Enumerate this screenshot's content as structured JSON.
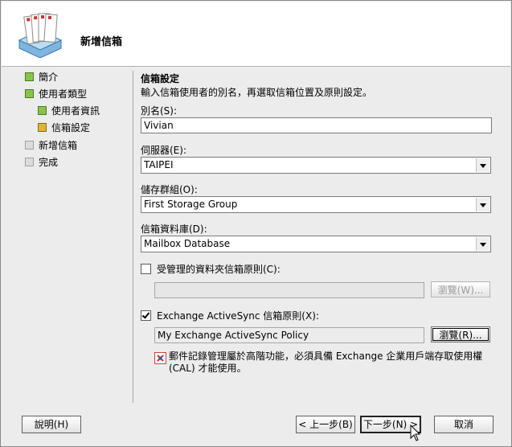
{
  "header": {
    "title": "新增信箱"
  },
  "steps": [
    {
      "label": "簡介",
      "state": "done"
    },
    {
      "label": "使用者類型",
      "state": "done"
    },
    {
      "label": "使用者資訊",
      "state": "done"
    },
    {
      "label": "信箱設定",
      "state": "current"
    },
    {
      "label": "新增信箱",
      "state": "pending"
    },
    {
      "label": "完成",
      "state": "pending"
    }
  ],
  "content": {
    "section_title": "信箱設定",
    "section_desc": "輸入信箱使用者的別名，再選取信箱位置及原則設定。",
    "alias_label": "別名(S):",
    "alias_value": "Vivian",
    "server_label": "伺服器(E):",
    "server_value": "TAIPEI",
    "storage_group_label": "儲存群組(O):",
    "storage_group_value": "First Storage Group",
    "mailbox_db_label": "信箱資料庫(D):",
    "mailbox_db_value": "Mailbox Database",
    "managed_folder_label": "受管理的資料夾信箱原則(C):",
    "managed_folder_checked": false,
    "managed_folder_value": "",
    "browse_w_label": "瀏覽(W)...",
    "activesync_label": "Exchange ActiveSync 信箱原則(X):",
    "activesync_checked": true,
    "activesync_value": "My Exchange ActiveSync Policy",
    "browse_r_label": "瀏覽(R)...",
    "note_text": "郵件記錄管理屬於高階功能，必須具備 Exchange 企業用戶端存取使用權 (CAL) 才能使用。"
  },
  "footer": {
    "help_label": "說明(H)",
    "back_label": "< 上一步(B)",
    "next_label": "下一步(N) >",
    "cancel_label": "取消"
  },
  "colors": {
    "done": "#8bc34a",
    "current": "#e0b43a",
    "pending": "#dcdcdc"
  }
}
